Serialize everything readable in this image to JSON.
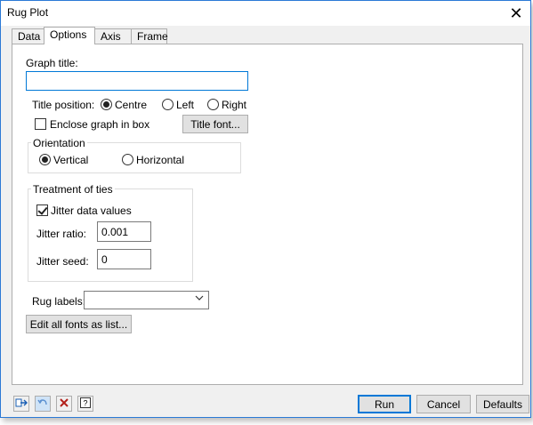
{
  "window": {
    "title": "Rug Plot"
  },
  "tabs": [
    {
      "label": "Data"
    },
    {
      "label": "Options"
    },
    {
      "label": "Axis"
    },
    {
      "label": "Frame"
    }
  ],
  "options": {
    "graph_title_label": "Graph title:",
    "graph_title_value": "",
    "title_position_label": "Title position:",
    "title_positions": [
      {
        "label": "Centre",
        "checked": true
      },
      {
        "label": "Left",
        "checked": false
      },
      {
        "label": "Right",
        "checked": false
      }
    ],
    "enclose_label": "Enclose graph in box",
    "title_font_button": "Title font...",
    "orientation_label": "Orientation",
    "orientation_vertical": "Vertical",
    "orientation_horizontal": "Horizontal",
    "ties_label": "Treatment of ties",
    "jitter_data_label": "Jitter data values",
    "jitter_ratio_label": "Jitter ratio:",
    "jitter_ratio_value": "0.001",
    "jitter_seed_label": "Jitter seed:",
    "jitter_seed_value": "0",
    "rug_labels_label": "Rug labels:",
    "rug_labels_value": "",
    "edit_fonts_button": "Edit all fonts as list..."
  },
  "footer": {
    "run": "Run",
    "cancel": "Cancel",
    "defaults": "Defaults"
  }
}
